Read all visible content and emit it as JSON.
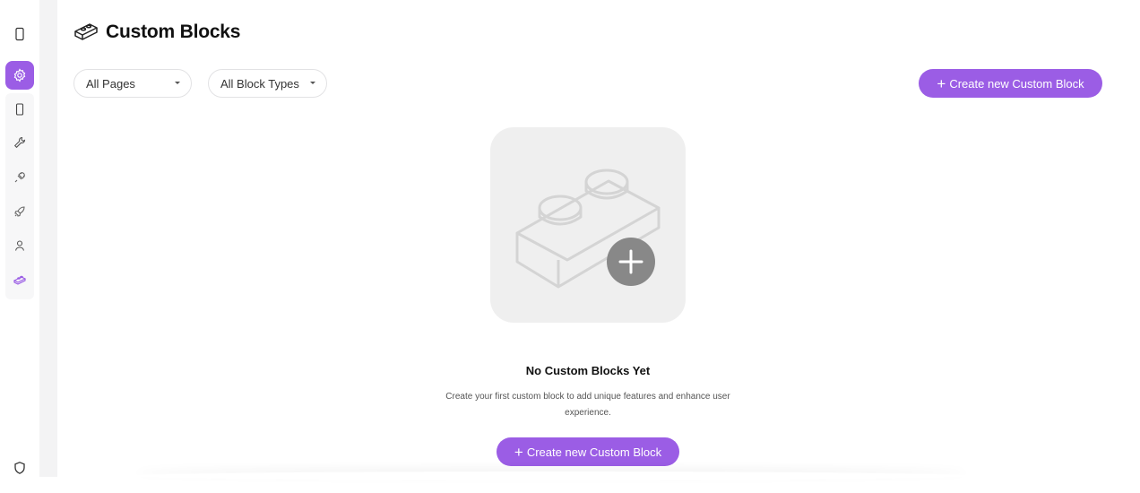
{
  "header": {
    "title": "Custom Blocks"
  },
  "filters": {
    "pages": "All Pages",
    "block_types": "All Block Types"
  },
  "actions": {
    "create_label": "Create new Custom Block",
    "create_plus": "+"
  },
  "empty_state": {
    "title": "No Custom Blocks Yet",
    "description": "Create your first custom block to add unique features and enhance user experience.",
    "cta_label": "Create new Custom Block",
    "cta_plus": "+"
  },
  "sidebar": {
    "items": [
      {
        "icon": "mobile-icon",
        "active": false
      },
      {
        "icon": "gear-icon",
        "active": true
      },
      {
        "icon": "mobile-icon",
        "active": false
      },
      {
        "icon": "wrench-icon",
        "active": false
      },
      {
        "icon": "plug-icon",
        "active": false
      },
      {
        "icon": "rocket-icon",
        "active": false
      },
      {
        "icon": "user-icon",
        "active": false
      },
      {
        "icon": "block-icon",
        "active": false
      },
      {
        "icon": "shield-icon",
        "active": false
      }
    ]
  },
  "colors": {
    "accent": "#9b5de5",
    "illustration_bg": "#efefef",
    "plus_circle": "#8a8a8a"
  }
}
